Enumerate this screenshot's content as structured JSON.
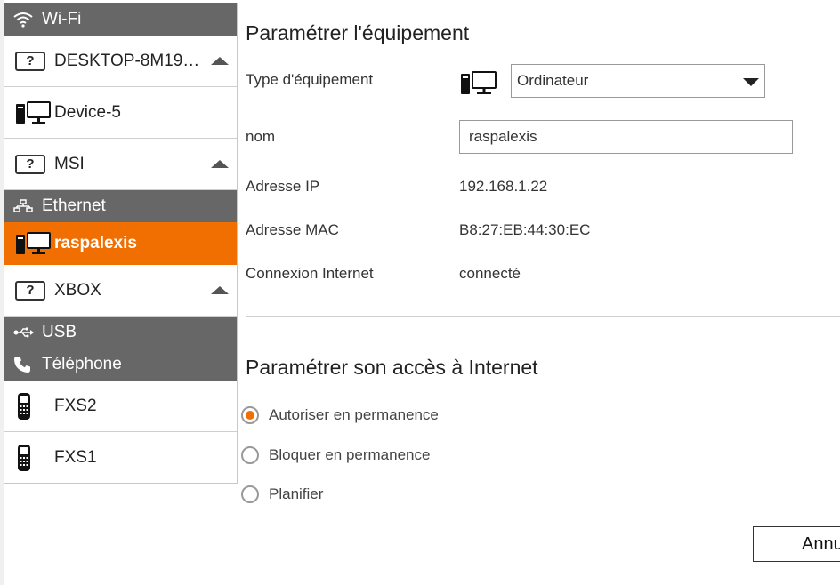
{
  "colors": {
    "accent": "#f16e00",
    "section_bg": "#676767"
  },
  "sidebar": {
    "sections": [
      {
        "name": "wifi",
        "label": "Wi-Fi",
        "icon": "wifi-icon",
        "items": [
          {
            "label": "DESKTOP-8M19…",
            "icon": "unknown-device-icon",
            "expanded": true
          },
          {
            "label": "Device-5",
            "icon": "computer-icon"
          },
          {
            "label": "MSI",
            "icon": "unknown-device-icon",
            "expanded": true
          }
        ]
      },
      {
        "name": "ethernet",
        "label": "Ethernet",
        "icon": "ethernet-icon",
        "items": [
          {
            "label": "raspalexis",
            "icon": "computer-icon",
            "selected": true
          },
          {
            "label": "XBOX",
            "icon": "unknown-device-icon",
            "expanded": true
          }
        ]
      },
      {
        "name": "usb",
        "label": "USB",
        "icon": "usb-icon",
        "items": []
      },
      {
        "name": "phone",
        "label": "Téléphone",
        "icon": "phone-icon",
        "items": [
          {
            "label": "FXS2",
            "icon": "handset-icon"
          },
          {
            "label": "FXS1",
            "icon": "handset-icon"
          }
        ]
      }
    ]
  },
  "main": {
    "title": "Paramétrer l'équipement",
    "fields": {
      "type_label": "Type d'équipement",
      "type_value": "Ordinateur",
      "name_label": "nom",
      "name_value": "raspalexis",
      "ip_label": "Adresse IP",
      "ip_value": "192.168.1.22",
      "mac_label": "Adresse MAC",
      "mac_value": "B8:27:EB:44:30:EC",
      "conn_label": "Connexion Internet",
      "conn_value": "connecté"
    },
    "access_title": "Paramétrer son accès à Internet",
    "access_options": [
      {
        "label": "Autoriser en permanence",
        "selected": true
      },
      {
        "label": "Bloquer en permanence",
        "selected": false
      },
      {
        "label": "Planifier",
        "selected": false
      }
    ],
    "cancel_label": "Annuler"
  }
}
